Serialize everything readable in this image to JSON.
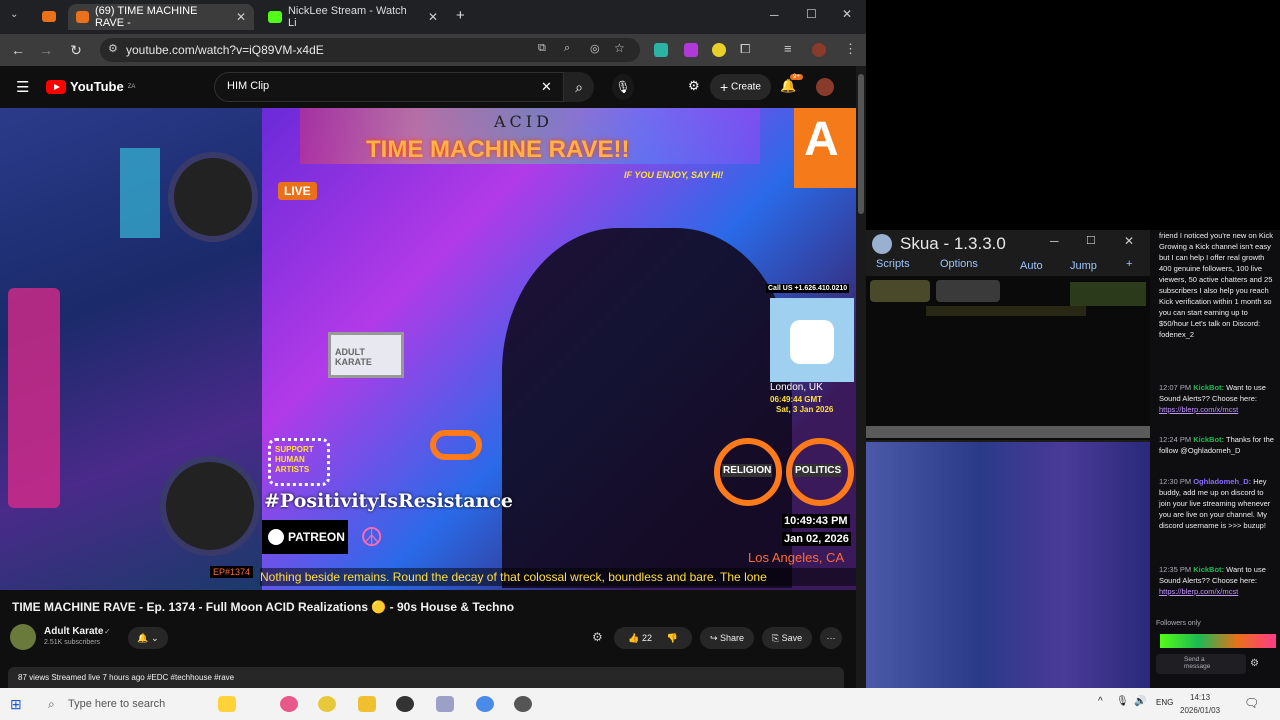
{
  "tabs": [
    {
      "label": "(69) TIME MACHINE RAVE -",
      "active": true
    },
    {
      "label": "NickLee Stream - Watch Li",
      "active": false
    }
  ],
  "address": {
    "url": "youtube.com/watch?v=iQ89VM-x4dE"
  },
  "youtube": {
    "logo": "YouTube",
    "logo_suffix": "ZA",
    "search_value": "HIM Clip",
    "create_label": "Create",
    "notif_count": "9+"
  },
  "video_overlay": {
    "acid": "ACID",
    "banner": "TIME MACHINE RAVE!!",
    "say_hi": "IF YOU ENJOY, SAY HI!",
    "live": "LIVE",
    "call_us": "Call US +1.626.410.0210",
    "london": "London, UK",
    "london_time": "06:49:44 GMT",
    "london_date": "Sat, 3 Jan 2026",
    "religion": "RELIGION",
    "politics": "POLITICS",
    "hashtag": "#PositivityIsResistance",
    "patreon": "PATREON",
    "la_time": "10:49:43 PM",
    "la_date": "Jan 02, 2026",
    "la_place": "Los Angeles, CA",
    "episode": "EP#1374",
    "ticker": "Nothing beside remains. Round the decay of that colossal wreck, boundless and bare. The lone",
    "support": "SUPPORT HUMAN ARTISTS",
    "adult_karate_sign": "ADULT KARATE"
  },
  "video": {
    "title": "TIME MACHINE RAVE - Ep. 1374 - Full Moon ACID Realizations 🟡 - 90s House & Techno",
    "channel": "Adult Karate",
    "subscribers": "2.51K subscribers",
    "likes": "22",
    "share": "Share",
    "save": "Save",
    "desc_meta": "87 views  Streamed live 7 hours ago  #EDC #techhouse #rave"
  },
  "skua": {
    "title": "Skua - 1.3.3.0",
    "menu": [
      "Scripts",
      "Options",
      "Auto",
      "Jump",
      "+"
    ]
  },
  "chat": {
    "messages": [
      {
        "time": "",
        "user": "",
        "text": "friend I noticed you're new on Kick Growing a Kick channel isn't easy but I can help I offer real growth 400 genuine followers, 100 live viewers, 50 active chatters and 25 subscribers I also help you reach Kick verification within 1 month so you can start earning up to $50/hour Let's talk on Discord: fodenex_2"
      },
      {
        "time": "12:07 PM",
        "user": "KickBot:",
        "text": "Want to use Sound Alerts?? Choose here:",
        "link": "https://blerp.com/x/mcst"
      },
      {
        "time": "12:24 PM",
        "user": "KickBot:",
        "text": "Thanks for the follow @Oghladomeh_D"
      },
      {
        "time": "12:30 PM",
        "user": "Oghladomeh_D:",
        "text": "Hey buddy, add me up on discord to join your live streaming whenever you are live on your channel. My discord username is >>> buzup!"
      },
      {
        "time": "12:35 PM",
        "user": "KickBot:",
        "text": "Want to use Sound Alerts?? Choose here:",
        "link": "https://blerp.com/x/mcst"
      }
    ],
    "followers_only": "Followers only",
    "send_placeholder": "Send a message"
  },
  "taskbar": {
    "search_placeholder": "Type here to search",
    "lang": "ENG",
    "time": "14:13",
    "date": "2026/01/03"
  }
}
